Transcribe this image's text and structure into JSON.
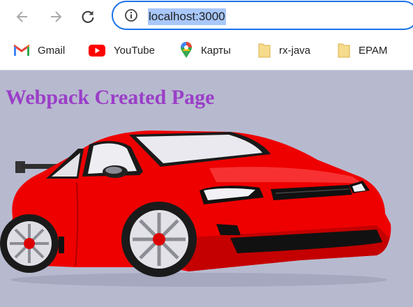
{
  "browser": {
    "url": "localhost:3000",
    "bookmarks": [
      {
        "label": "Gmail",
        "icon": "gmail-icon"
      },
      {
        "label": "YouTube",
        "icon": "youtube-icon"
      },
      {
        "label": "Карты",
        "icon": "maps-icon"
      },
      {
        "label": "rx-java",
        "icon": "folder-icon"
      },
      {
        "label": "EPAM",
        "icon": "folder-icon"
      }
    ]
  },
  "page": {
    "heading": "Webpack Created Page",
    "background_color": "#b7bacf",
    "heading_color": "#9b3ec8",
    "image": "red-sports-car"
  }
}
